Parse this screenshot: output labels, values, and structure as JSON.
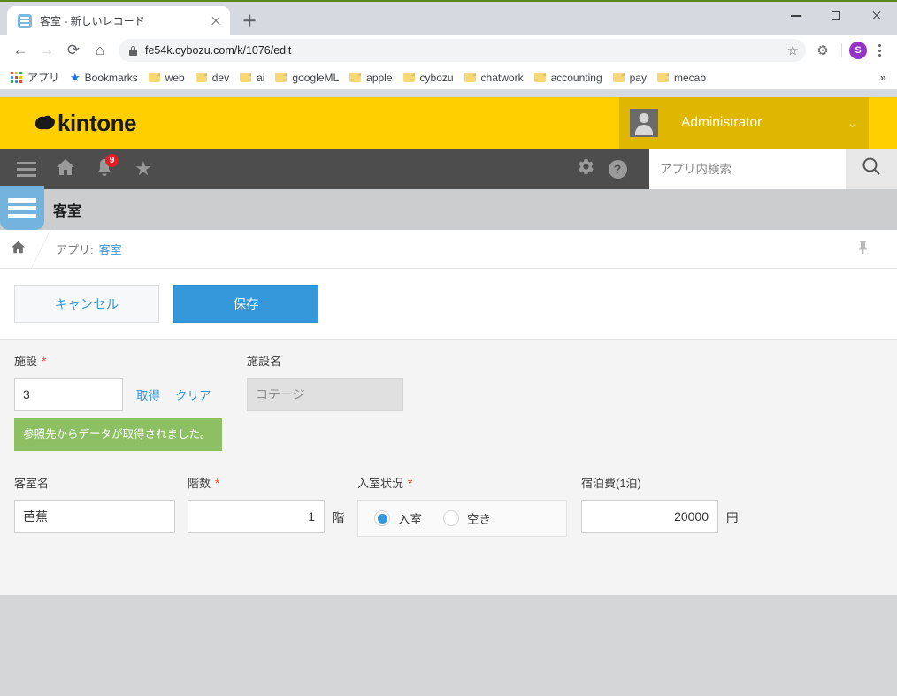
{
  "browser": {
    "tab": {
      "title": "客室 - 新しいレコード",
      "favicon": "kintone-record-icon",
      "close": "close-icon"
    },
    "new_tab": "+",
    "window_controls": {
      "minimize": "minimize-icon",
      "maximize": "maximize-icon",
      "close": "close-icon"
    },
    "nav": {
      "back": "←",
      "forward": "→",
      "reload": "⟳",
      "home": "⌂"
    },
    "omnibox": {
      "url": "fe54k.cybozu.com/k/1076/edit",
      "lock": "lock-icon",
      "star": "☆"
    },
    "extension_icon": "⚙",
    "profile_initial": "S",
    "menu": "kebab-menu-icon",
    "bookmarks": [
      {
        "label": "アプリ",
        "icon": "apps-grid-icon"
      },
      {
        "label": "Bookmarks",
        "icon": "star-icon"
      },
      {
        "label": "web",
        "icon": "folder-icon"
      },
      {
        "label": "dev",
        "icon": "folder-icon"
      },
      {
        "label": "ai",
        "icon": "folder-icon"
      },
      {
        "label": "googleML",
        "icon": "folder-icon"
      },
      {
        "label": "apple",
        "icon": "folder-icon"
      },
      {
        "label": "cybozu",
        "icon": "folder-icon"
      },
      {
        "label": "chatwork",
        "icon": "folder-icon"
      },
      {
        "label": "accounting",
        "icon": "folder-icon"
      },
      {
        "label": "pay",
        "icon": "folder-icon"
      },
      {
        "label": "mecab",
        "icon": "folder-icon"
      }
    ],
    "bookmarks_overflow": "»"
  },
  "kintone": {
    "logo_text": "kintone",
    "user_name": "Administrator",
    "user_caret": "⌄",
    "nav": {
      "menu": "hamburger-icon",
      "home": "⌂",
      "notifications_badge": "9",
      "favorites": "★",
      "gear": "⚙",
      "help": "?"
    },
    "search": {
      "placeholder": "アプリ内検索",
      "value": "",
      "button": "search-icon"
    },
    "app_name": "客室",
    "breadcrumb": {
      "home": "⌂",
      "prefix": "アプリ:",
      "link": "客室"
    },
    "pin": "pin-icon",
    "actions": {
      "cancel": "キャンセル",
      "save": "保存"
    }
  },
  "form": {
    "facility": {
      "label": "施設",
      "required": "*",
      "value": "3",
      "lookup_button": "取得",
      "clear_button": "クリア",
      "message": "参照先からデータが取得されました。"
    },
    "facility_name": {
      "label": "施設名",
      "value": "コテージ",
      "readonly": true
    },
    "room_name": {
      "label": "客室名",
      "value": "芭蕉"
    },
    "floor": {
      "label": "階数",
      "required": "*",
      "value": "1",
      "unit": "階"
    },
    "occupancy": {
      "label": "入室状況",
      "required": "*",
      "options": [
        {
          "label": "入室",
          "selected": true
        },
        {
          "label": "空き",
          "selected": false
        }
      ]
    },
    "rate": {
      "label": "宿泊費(1泊)",
      "value": "20000",
      "unit": "円"
    }
  },
  "colors": {
    "kintone_yellow": "#ffcf00",
    "kintone_yellow_dark": "#e0b700",
    "nav_gray": "#4d4d4d",
    "accent_blue": "#3498db",
    "success_green": "#8cc063",
    "required_red": "#e74c3c",
    "badge_red": "#e51c23"
  }
}
